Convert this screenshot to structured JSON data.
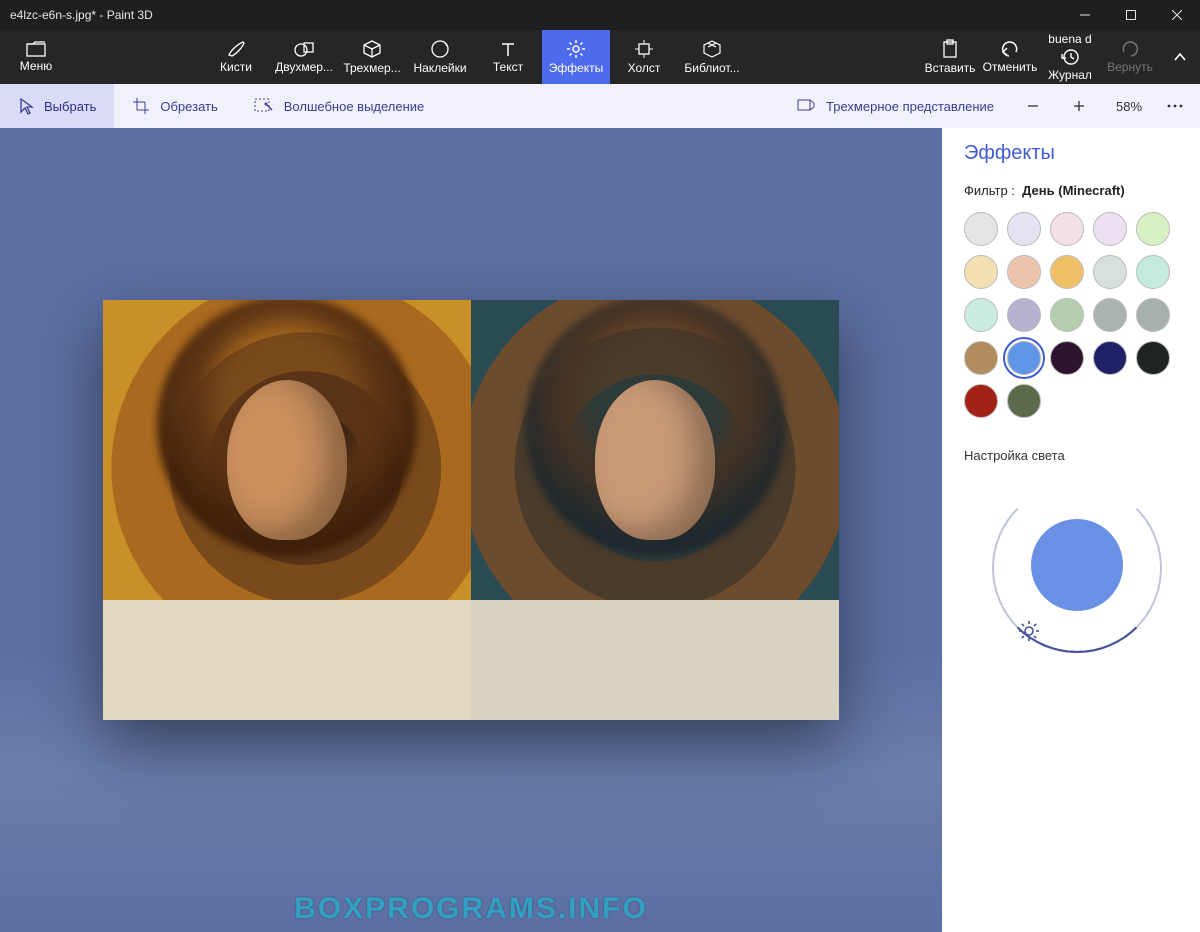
{
  "title": "e4lzc-e6n-s.jpg* - Paint 3D",
  "ribbon": {
    "menu": "Меню",
    "tools": [
      {
        "id": "brushes",
        "label": "Кисти"
      },
      {
        "id": "2d",
        "label": "Двухмер..."
      },
      {
        "id": "3d",
        "label": "Трехмер..."
      },
      {
        "id": "stickers",
        "label": "Наклейки"
      },
      {
        "id": "text",
        "label": "Текст"
      },
      {
        "id": "effects",
        "label": "Эффекты",
        "active": true
      },
      {
        "id": "canvas",
        "label": "Холст"
      },
      {
        "id": "library",
        "label": "Библиот..."
      }
    ],
    "right": [
      {
        "id": "paste",
        "label": "Вставить"
      },
      {
        "id": "undo",
        "label": "Отменить"
      },
      {
        "id": "history",
        "label": "Журнал"
      },
      {
        "id": "redo",
        "label": "Вернуть",
        "disabled": true
      }
    ]
  },
  "subbar": {
    "select": "Выбрать",
    "crop": "Обрезать",
    "magic": "Волшебное выделение",
    "view3d": "Трехмерное представление",
    "zoom": "58%"
  },
  "panel": {
    "title": "Эффекты",
    "filter_label": "Фильтр :",
    "filter_value": "День (Minecraft)",
    "light_label": "Настройка света",
    "swatches": [
      "#e3e6e3",
      "#e6e3f1",
      "#f3e0e8",
      "#ece1f1",
      "#d7f0c2",
      "#f2dfb2",
      "#eec3ae",
      "#f0c069",
      "#d6e1dd",
      "#c4ecdd",
      "#cbeae2",
      "#b6b2cf",
      "#b4cdac",
      "#aab2b2",
      "#a7b0ad",
      "#b08c5e",
      "#5f94e6",
      "#2f1430",
      "#1f2066",
      "#1f2322",
      "#a22315",
      "#5a6a4a"
    ],
    "selected_swatch_index": 16
  },
  "watermark": "BOXPROGRAMS.INFO"
}
